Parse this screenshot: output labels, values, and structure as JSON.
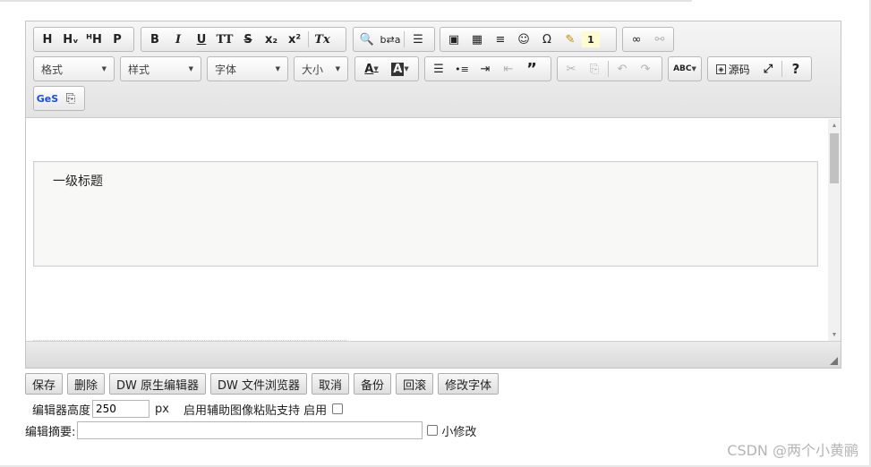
{
  "toolbar": {
    "row1": {
      "headings": [
        "H",
        "Hᵥ",
        "ᴴH",
        "P"
      ],
      "format_buttons": [
        "B",
        "I",
        "U",
        "TT",
        "S",
        "x₂",
        "x²",
        "Tx"
      ],
      "find_buttons": [
        "🔍",
        "b⇄a",
        "☰"
      ],
      "insert_buttons": [
        "▣",
        "▦",
        "≡",
        "☺",
        "Ω",
        "✎",
        "1"
      ],
      "link_buttons": [
        "∞",
        "⚯"
      ]
    },
    "row2": {
      "format_combo": "格式",
      "style_combo": "样式",
      "font_combo": "字体",
      "size_combo": "大小",
      "text_color": "A",
      "bg_color": "A",
      "list_buttons": [
        "☰",
        "•≡",
        "⇥",
        "⇤",
        "”"
      ],
      "edit_buttons": [
        "✂",
        "⎘",
        "↶",
        "↷"
      ],
      "spell_label": "ABC",
      "source_label": "源码",
      "maximize": "⤢",
      "help": "?"
    },
    "row3": {
      "ges_label": "GeS",
      "clipboard": "⎘"
    }
  },
  "content": {
    "heading_text": "一级标题"
  },
  "actions": {
    "buttons": [
      "保存",
      "删除",
      "DW 原生编辑器",
      "DW 文件浏览器",
      "取消",
      "备份",
      "回滚",
      "修改字体"
    ]
  },
  "settings": {
    "height_label": "编辑器高度",
    "height_value": "250",
    "height_unit": "px",
    "paste_label": "启用辅助图像粘贴支持 启用",
    "summary_label": "编辑摘要:",
    "minor_edit_label": "小修改"
  },
  "watermark": "CSDN @两个小黄鹂"
}
